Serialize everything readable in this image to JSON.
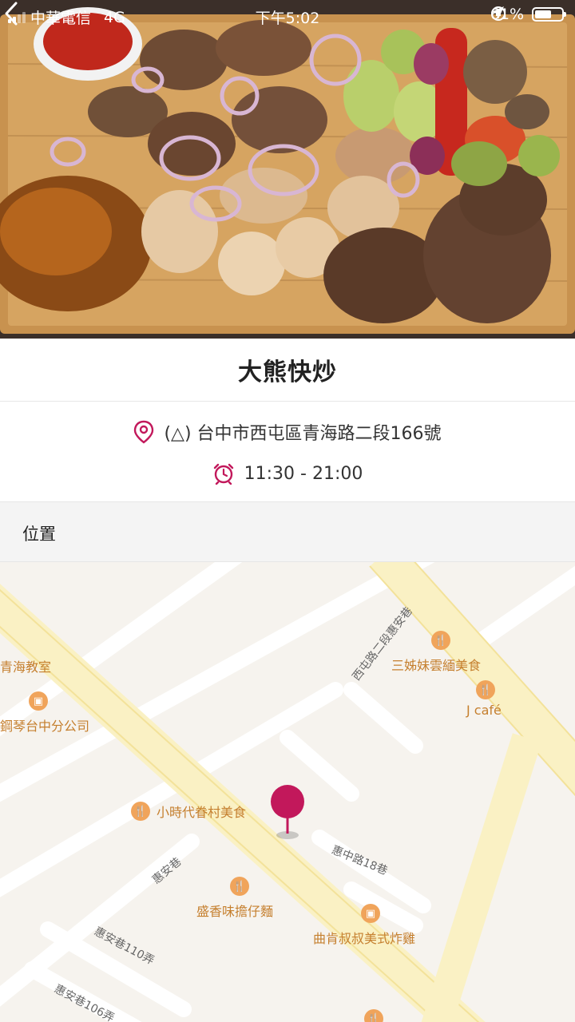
{
  "status_bar": {
    "carrier": "中華電信",
    "network": "4G",
    "time": "下午5:02",
    "battery": "61%",
    "battery_level": 0.61
  },
  "restaurant": {
    "name": "大熊快炒",
    "address": "(△) 台中市西屯區青海路二段166號",
    "hours": "11:30 - 21:00"
  },
  "section": {
    "location_label": "位置"
  },
  "map": {
    "pois": [
      {
        "label": "三姊妹雲緬美食",
        "icon": "restaurant-icon"
      },
      {
        "label": "J café",
        "icon": "cafe-icon"
      },
      {
        "label": "青海教室",
        "icon": ""
      },
      {
        "label": "鋼琴台中分公司",
        "icon": "shop-icon"
      },
      {
        "label": "小時代眷村美食",
        "icon": "restaurant-icon"
      },
      {
        "label": "盛香味擔仔麵",
        "icon": "restaurant-icon"
      },
      {
        "label": "曲肯叔叔美式炸雞",
        "icon": "shop-icon"
      }
    ],
    "streets": [
      "西屯路二段惠安巷",
      "惠中路18巷",
      "惠安巷",
      "惠安巷110弄",
      "惠安巷106弄"
    ],
    "pin_color": "#c2185b"
  },
  "colors": {
    "accent": "#c2185b",
    "poi": "#f0a45b"
  }
}
